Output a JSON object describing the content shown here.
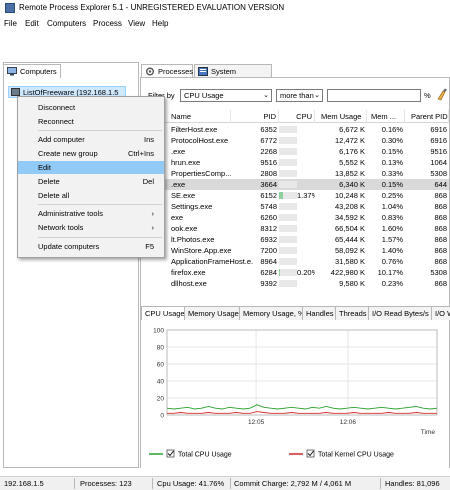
{
  "window": {
    "title": "Remote Process Explorer 5.1 - UNREGISTERED EVALUATION VERSION"
  },
  "menubar": [
    "File",
    "Edit",
    "Computers",
    "Process",
    "View",
    "Help"
  ],
  "left_panel": {
    "tab_label": "Computers",
    "computer_node": "ListOfFreeware (192.168.1.5"
  },
  "right_panel": {
    "tabs": [
      "Processes",
      "System Information"
    ],
    "filter": {
      "label": "Filter by",
      "field": "CPU Usage",
      "operator": "more than",
      "value": "",
      "unit": "%"
    },
    "columns": [
      "Name",
      "PID",
      "CPU",
      "Mem Usage",
      "Mem ...",
      "Parent PID"
    ],
    "rows": [
      {
        "name": "FilterHost.exe",
        "pid": "6352",
        "cpu": "",
        "cpu_level": 0,
        "mem": "6,672 K",
        "memp": "0.16%",
        "ppid": "6916"
      },
      {
        "name": "ProtocolHost.exe",
        "pid": "6772",
        "cpu": "",
        "cpu_level": 0,
        "mem": "12,472 K",
        "memp": "0.30%",
        "ppid": "6916"
      },
      {
        "name": ".exe",
        "pid": "2268",
        "cpu": "",
        "cpu_level": 0,
        "mem": "6,176 K",
        "memp": "0.15%",
        "ppid": "9516"
      },
      {
        "name": "hrun.exe",
        "pid": "9516",
        "cpu": "",
        "cpu_level": 0,
        "mem": "5,552 K",
        "memp": "0.13%",
        "ppid": "1064"
      },
      {
        "name": "PropertiesComp...",
        "pid": "2808",
        "cpu": "",
        "cpu_level": 0,
        "mem": "13,852 K",
        "memp": "0.33%",
        "ppid": "5308"
      },
      {
        "name": ".exe",
        "pid": "3664",
        "cpu": "",
        "cpu_level": 0,
        "mem": "6,340 K",
        "memp": "0.15%",
        "ppid": "644"
      },
      {
        "name": "SE.exe",
        "pid": "6152",
        "cpu": "1.37%",
        "cpu_level": 0.2,
        "mem": "10,248 K",
        "memp": "0.25%",
        "ppid": "868"
      },
      {
        "name": "Settings.exe",
        "pid": "5748",
        "cpu": "",
        "cpu_level": 0,
        "mem": "43,208 K",
        "memp": "1.04%",
        "ppid": "868"
      },
      {
        "name": "exe",
        "pid": "6260",
        "cpu": "",
        "cpu_level": 0,
        "mem": "34,592 K",
        "memp": "0.83%",
        "ppid": "868"
      },
      {
        "name": "ook.exe",
        "pid": "8312",
        "cpu": "",
        "cpu_level": 0,
        "mem": "66,504 K",
        "memp": "1.60%",
        "ppid": "868"
      },
      {
        "name": "lt.Photos.exe",
        "pid": "6932",
        "cpu": "",
        "cpu_level": 0,
        "mem": "65,444 K",
        "memp": "1.57%",
        "ppid": "868"
      },
      {
        "name": "WinStore.App.exe",
        "pid": "7200",
        "cpu": "",
        "cpu_level": 0,
        "mem": "58,092 K",
        "memp": "1.40%",
        "ppid": "868"
      },
      {
        "name": "ApplicationFrameHost.e...",
        "pid": "8964",
        "cpu": "",
        "cpu_level": 0,
        "mem": "31,580 K",
        "memp": "0.76%",
        "ppid": "868"
      },
      {
        "name": "firefox.exe",
        "pid": "6284",
        "cpu": "0.20%",
        "cpu_level": 0.06,
        "mem": "422,980 K",
        "memp": "10.17%",
        "ppid": "5308"
      },
      {
        "name": "dllhost.exe",
        "pid": "9392",
        "cpu": "",
        "cpu_level": 0,
        "mem": "9,580 K",
        "memp": "0.23%",
        "ppid": "868"
      }
    ],
    "selected_row": 5,
    "bottom_tabs": [
      "CPU Usage",
      "Memory Usage",
      "Memory Usage, %",
      "Handles",
      "Threads",
      "I/O Read Bytes/s",
      "I/O W"
    ]
  },
  "context_menu": {
    "items": [
      {
        "label": "Disconnect",
        "shortcut": ""
      },
      {
        "label": "Reconnect",
        "shortcut": ""
      },
      {
        "label": "Add computer",
        "shortcut": "Ins"
      },
      {
        "label": "Create new group",
        "shortcut": "Ctrl+Ins"
      },
      {
        "label": "Edit",
        "shortcut": ""
      },
      {
        "label": "Delete",
        "shortcut": "Del"
      },
      {
        "label": "Delete all",
        "shortcut": ""
      },
      {
        "label": "Administrative tools",
        "shortcut": ""
      },
      {
        "label": "Network tools",
        "shortcut": ""
      },
      {
        "label": "Update computers",
        "shortcut": "F5"
      }
    ],
    "highlighted": "Edit"
  },
  "chart_data": {
    "type": "line",
    "yticks": [
      "100",
      "80",
      "60",
      "40",
      "20",
      "0"
    ],
    "ylim": [
      0,
      100
    ],
    "xticks": [
      "12:05",
      "12:06"
    ],
    "xlabel": "Time",
    "legend_placement": "bottom",
    "series": [
      {
        "name": "Total CPU Usage",
        "color": "#2ca02c",
        "values": [
          8,
          7,
          8,
          9,
          7,
          8,
          10,
          8,
          7,
          9,
          8,
          7,
          8,
          12,
          9,
          8,
          7,
          8,
          9,
          8,
          7,
          9,
          8,
          10,
          8,
          7,
          8,
          9,
          8,
          7,
          8,
          9,
          8,
          7,
          8,
          9,
          10,
          8,
          7,
          8
        ]
      },
      {
        "name": "Total Kernel CPU Usage",
        "color": "#d62728",
        "values": [
          2,
          2,
          3,
          2,
          2,
          2,
          3,
          2,
          2,
          2,
          3,
          2,
          2,
          4,
          3,
          2,
          2,
          2,
          3,
          2,
          2,
          2,
          2,
          3,
          2,
          2,
          2,
          3,
          2,
          2,
          2,
          2,
          3,
          2,
          2,
          2,
          3,
          2,
          2,
          2
        ]
      }
    ]
  },
  "status": {
    "ip": "192.168.1.5",
    "processes": "Processes: 123",
    "cpu": "Cpu Usage: 41.76%",
    "commit": "Commit Charge: 2,792 M / 4,061 M",
    "handles": "Handles: 81,096"
  }
}
